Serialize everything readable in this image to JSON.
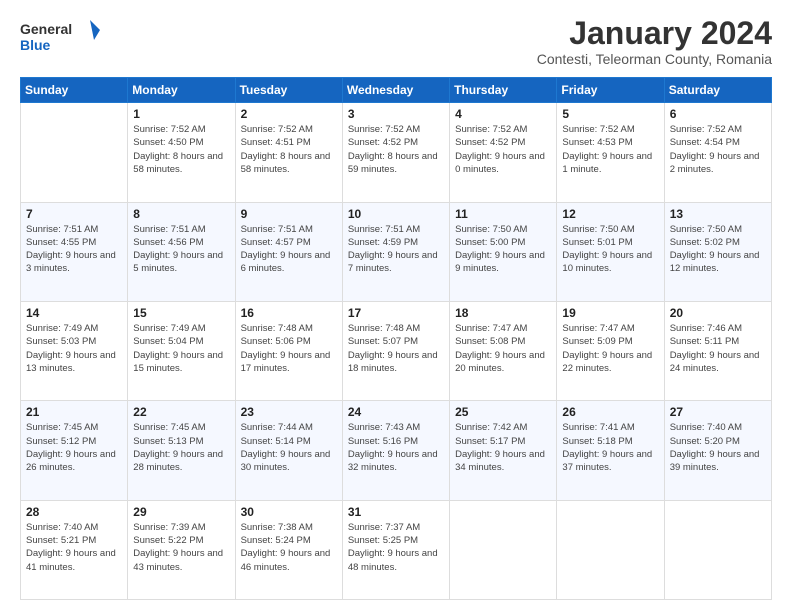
{
  "logo": {
    "text_general": "General",
    "text_blue": "Blue"
  },
  "header": {
    "month_title": "January 2024",
    "subtitle": "Contesti, Teleorman County, Romania"
  },
  "weekdays": [
    "Sunday",
    "Monday",
    "Tuesday",
    "Wednesday",
    "Thursday",
    "Friday",
    "Saturday"
  ],
  "weeks": [
    [
      {
        "day": "",
        "info": ""
      },
      {
        "day": "1",
        "info": "Sunrise: 7:52 AM\nSunset: 4:50 PM\nDaylight: 8 hours\nand 58 minutes."
      },
      {
        "day": "2",
        "info": "Sunrise: 7:52 AM\nSunset: 4:51 PM\nDaylight: 8 hours\nand 58 minutes."
      },
      {
        "day": "3",
        "info": "Sunrise: 7:52 AM\nSunset: 4:52 PM\nDaylight: 8 hours\nand 59 minutes."
      },
      {
        "day": "4",
        "info": "Sunrise: 7:52 AM\nSunset: 4:52 PM\nDaylight: 9 hours\nand 0 minutes."
      },
      {
        "day": "5",
        "info": "Sunrise: 7:52 AM\nSunset: 4:53 PM\nDaylight: 9 hours\nand 1 minute."
      },
      {
        "day": "6",
        "info": "Sunrise: 7:52 AM\nSunset: 4:54 PM\nDaylight: 9 hours\nand 2 minutes."
      }
    ],
    [
      {
        "day": "7",
        "info": "Sunrise: 7:51 AM\nSunset: 4:55 PM\nDaylight: 9 hours\nand 3 minutes."
      },
      {
        "day": "8",
        "info": "Sunrise: 7:51 AM\nSunset: 4:56 PM\nDaylight: 9 hours\nand 5 minutes."
      },
      {
        "day": "9",
        "info": "Sunrise: 7:51 AM\nSunset: 4:57 PM\nDaylight: 9 hours\nand 6 minutes."
      },
      {
        "day": "10",
        "info": "Sunrise: 7:51 AM\nSunset: 4:59 PM\nDaylight: 9 hours\nand 7 minutes."
      },
      {
        "day": "11",
        "info": "Sunrise: 7:50 AM\nSunset: 5:00 PM\nDaylight: 9 hours\nand 9 minutes."
      },
      {
        "day": "12",
        "info": "Sunrise: 7:50 AM\nSunset: 5:01 PM\nDaylight: 9 hours\nand 10 minutes."
      },
      {
        "day": "13",
        "info": "Sunrise: 7:50 AM\nSunset: 5:02 PM\nDaylight: 9 hours\nand 12 minutes."
      }
    ],
    [
      {
        "day": "14",
        "info": "Sunrise: 7:49 AM\nSunset: 5:03 PM\nDaylight: 9 hours\nand 13 minutes."
      },
      {
        "day": "15",
        "info": "Sunrise: 7:49 AM\nSunset: 5:04 PM\nDaylight: 9 hours\nand 15 minutes."
      },
      {
        "day": "16",
        "info": "Sunrise: 7:48 AM\nSunset: 5:06 PM\nDaylight: 9 hours\nand 17 minutes."
      },
      {
        "day": "17",
        "info": "Sunrise: 7:48 AM\nSunset: 5:07 PM\nDaylight: 9 hours\nand 18 minutes."
      },
      {
        "day": "18",
        "info": "Sunrise: 7:47 AM\nSunset: 5:08 PM\nDaylight: 9 hours\nand 20 minutes."
      },
      {
        "day": "19",
        "info": "Sunrise: 7:47 AM\nSunset: 5:09 PM\nDaylight: 9 hours\nand 22 minutes."
      },
      {
        "day": "20",
        "info": "Sunrise: 7:46 AM\nSunset: 5:11 PM\nDaylight: 9 hours\nand 24 minutes."
      }
    ],
    [
      {
        "day": "21",
        "info": "Sunrise: 7:45 AM\nSunset: 5:12 PM\nDaylight: 9 hours\nand 26 minutes."
      },
      {
        "day": "22",
        "info": "Sunrise: 7:45 AM\nSunset: 5:13 PM\nDaylight: 9 hours\nand 28 minutes."
      },
      {
        "day": "23",
        "info": "Sunrise: 7:44 AM\nSunset: 5:14 PM\nDaylight: 9 hours\nand 30 minutes."
      },
      {
        "day": "24",
        "info": "Sunrise: 7:43 AM\nSunset: 5:16 PM\nDaylight: 9 hours\nand 32 minutes."
      },
      {
        "day": "25",
        "info": "Sunrise: 7:42 AM\nSunset: 5:17 PM\nDaylight: 9 hours\nand 34 minutes."
      },
      {
        "day": "26",
        "info": "Sunrise: 7:41 AM\nSunset: 5:18 PM\nDaylight: 9 hours\nand 37 minutes."
      },
      {
        "day": "27",
        "info": "Sunrise: 7:40 AM\nSunset: 5:20 PM\nDaylight: 9 hours\nand 39 minutes."
      }
    ],
    [
      {
        "day": "28",
        "info": "Sunrise: 7:40 AM\nSunset: 5:21 PM\nDaylight: 9 hours\nand 41 minutes."
      },
      {
        "day": "29",
        "info": "Sunrise: 7:39 AM\nSunset: 5:22 PM\nDaylight: 9 hours\nand 43 minutes."
      },
      {
        "day": "30",
        "info": "Sunrise: 7:38 AM\nSunset: 5:24 PM\nDaylight: 9 hours\nand 46 minutes."
      },
      {
        "day": "31",
        "info": "Sunrise: 7:37 AM\nSunset: 5:25 PM\nDaylight: 9 hours\nand 48 minutes."
      },
      {
        "day": "",
        "info": ""
      },
      {
        "day": "",
        "info": ""
      },
      {
        "day": "",
        "info": ""
      }
    ]
  ]
}
